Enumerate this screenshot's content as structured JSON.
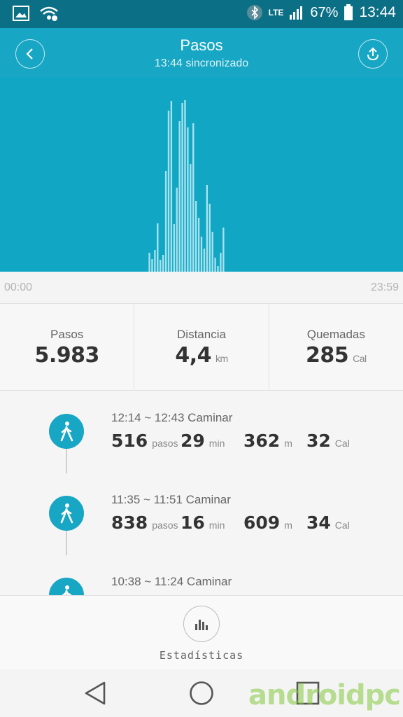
{
  "status_bar": {
    "network": "LTE",
    "battery": "67%",
    "time": "13:44",
    "icons": [
      "image-icon",
      "wifi-icon",
      "bluetooth-icon",
      "signal-icon",
      "battery-icon"
    ]
  },
  "header": {
    "title": "Pasos",
    "subtitle": "13:44 sincronizado",
    "back_icon": "chevron-left-icon",
    "share_icon": "upload-icon"
  },
  "chart_data": {
    "type": "bar",
    "x_start": "00:00",
    "x_end": "23:59",
    "color": "#a8e2ee",
    "background": "#11a7c4",
    "values": [
      0,
      0,
      0,
      0,
      0,
      0,
      0,
      0,
      0,
      0,
      0,
      0,
      0,
      0,
      0,
      0,
      0,
      0,
      0,
      0,
      0,
      0,
      0,
      0,
      0,
      0,
      0,
      0,
      0,
      0,
      0,
      0,
      0,
      0,
      0,
      0,
      0,
      0,
      0,
      0,
      0,
      0,
      0,
      0,
      0,
      0,
      0,
      0,
      0,
      0,
      0,
      0,
      0,
      0,
      27,
      18,
      31,
      69,
      17,
      24,
      144,
      230,
      244,
      68,
      120,
      215,
      241,
      245,
      206,
      154,
      212,
      101,
      77,
      50,
      33,
      124,
      97,
      57,
      20,
      8,
      27,
      63,
      0,
      0,
      0,
      0,
      0,
      0,
      0,
      0,
      0,
      0,
      0,
      0,
      0,
      0,
      0,
      0,
      0,
      0,
      0,
      0,
      0,
      0,
      0,
      0,
      0,
      0,
      0,
      0,
      0,
      0,
      0,
      0,
      0,
      0,
      0,
      0,
      0,
      0,
      0,
      0,
      0,
      0,
      0,
      0,
      0,
      0,
      0,
      0,
      0,
      0,
      0,
      0,
      0,
      0,
      0,
      0,
      0,
      0,
      0,
      0,
      0,
      0,
      0,
      0,
      0
    ]
  },
  "summary": [
    {
      "label": "Pasos",
      "value": "5.983",
      "unit": ""
    },
    {
      "label": "Distancia",
      "value": "4,4",
      "unit": "km"
    },
    {
      "label": "Quemadas",
      "value": "285",
      "unit": "Cal"
    }
  ],
  "activities": [
    {
      "time": "12:14 ~ 12:43 Caminar",
      "steps": "516",
      "steps_unit": "pasos",
      "duration": "29",
      "duration_unit": "min",
      "distance": "362",
      "distance_unit": "m",
      "calories": "32",
      "calories_unit": "Cal"
    },
    {
      "time": "11:35 ~ 11:51 Caminar",
      "steps": "838",
      "steps_unit": "pasos",
      "duration": "16",
      "duration_unit": "min",
      "distance": "609",
      "distance_unit": "m",
      "calories": "34",
      "calories_unit": "Cal"
    },
    {
      "time": "10:38 ~ 11:24 Caminar"
    }
  ],
  "bottom": {
    "stats_label": "Estadísticas",
    "stats_icon": "bar-chart-icon"
  },
  "navbar": {
    "back_icon": "back-triangle-icon",
    "home_icon": "home-circle-icon",
    "recents_icon": "recents-square-icon",
    "watermark": "androidpc"
  }
}
